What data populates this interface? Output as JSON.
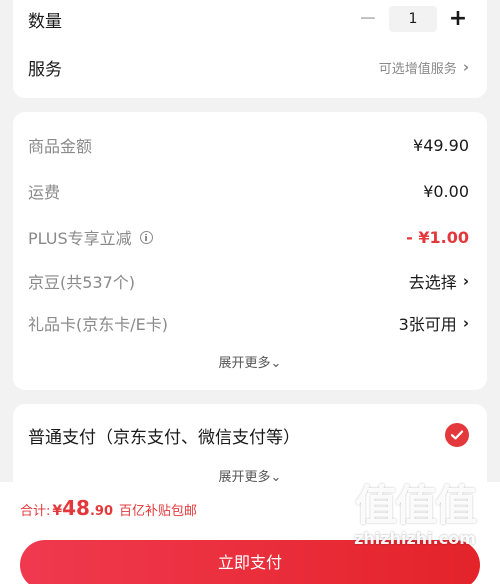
{
  "quantity": {
    "label": "数量",
    "value": "1",
    "minus": "−",
    "plus": "+"
  },
  "service": {
    "label": "服务",
    "hint": "可选增值服务",
    "chevron": "›"
  },
  "price_rows": {
    "goods": {
      "label": "商品金额",
      "value": "¥49.90"
    },
    "shipping": {
      "label": "运费",
      "value": "¥0.00"
    },
    "plus": {
      "label": "PLUS专享立减",
      "value": "- ¥1.00"
    },
    "jingdou": {
      "label": "京豆(共537个)",
      "value": "去选择",
      "chevron": "›"
    },
    "giftcard": {
      "label": "礼品卡(京东卡/E卡)",
      "value": "3张可用",
      "chevron": "›"
    },
    "expand": "展开更多⌄"
  },
  "payment": {
    "label": "普通支付（京东支付、微信支付等）",
    "expand": "展开更多⌄"
  },
  "footer": {
    "total_label": "合计:",
    "total_yen": "¥",
    "total_int": "48",
    "total_dec": ".90",
    "total_note": "百亿补贴包邮",
    "pay_button": "立即支付"
  },
  "watermark": {
    "logo": "值值值",
    "url": "zhizhizhi.com"
  },
  "colors": {
    "accent": "#e4393c",
    "background": "#f2f2f2"
  },
  "icons": {
    "info": "info-icon",
    "check": "check-icon",
    "chevron": "chevron-right-icon"
  }
}
